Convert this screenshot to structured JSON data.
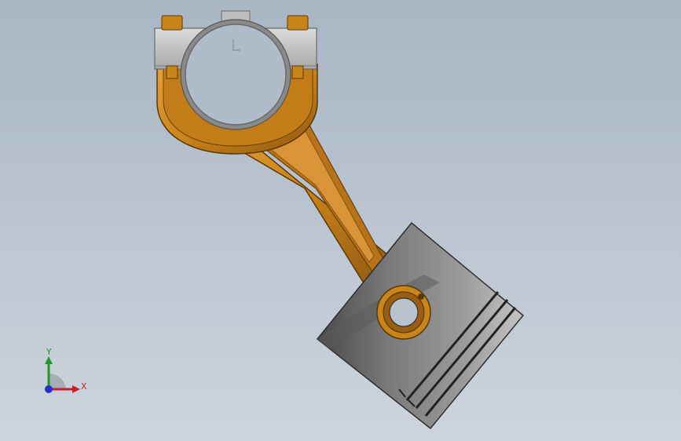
{
  "viewport": {
    "background_top": "#a9b6c4",
    "background_bottom": "#cdd4dc"
  },
  "model": {
    "rod_color": "#c9841a",
    "cap_color": "#c7c7c7",
    "piston_color": "#6a6a6a",
    "bolt_color": "#b8781c"
  },
  "triad": {
    "x_label": "X",
    "y_label": "Y",
    "x_color": "#c0242a",
    "y_color": "#1f9a2a",
    "z_color": "#2233cc"
  }
}
